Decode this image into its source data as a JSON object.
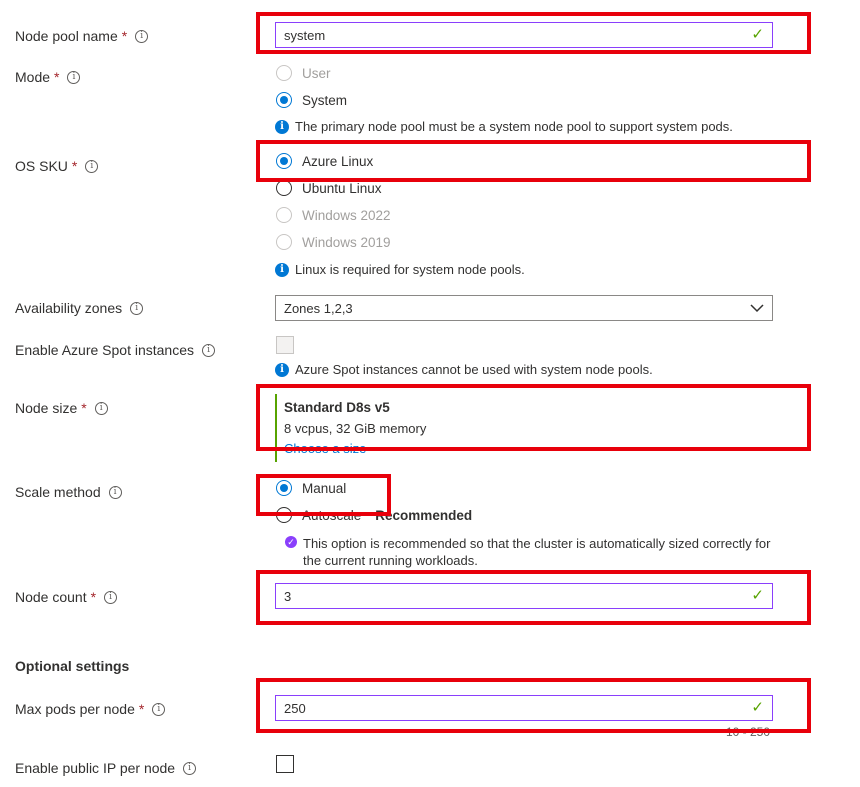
{
  "fields": {
    "node_pool_name": {
      "label": "Node pool name",
      "value": "system"
    },
    "mode": {
      "label": "Mode",
      "options": [
        "User",
        "System"
      ],
      "note": "The primary node pool must be a system node pool to support system pods."
    },
    "os_sku": {
      "label": "OS SKU",
      "options": [
        "Azure Linux",
        "Ubuntu Linux",
        "Windows 2022",
        "Windows 2019"
      ],
      "note": "Linux is required for system node pools."
    },
    "availability_zones": {
      "label": "Availability zones",
      "value": "Zones 1,2,3"
    },
    "spot": {
      "label": "Enable Azure Spot instances",
      "note": "Azure Spot instances cannot be used with system node pools."
    },
    "node_size": {
      "label": "Node size",
      "name": "Standard D8s v5",
      "specs": "8 vcpus, 32 GiB memory",
      "link": "Choose a size"
    },
    "scale_method": {
      "label": "Scale method",
      "options": [
        "Manual",
        "Autoscale"
      ],
      "recommended": "Recommended",
      "note": "This option is recommended so that the cluster is automatically sized correctly for the current running workloads."
    },
    "node_count": {
      "label": "Node count",
      "value": "3"
    },
    "optional_heading": "Optional settings",
    "max_pods": {
      "label": "Max pods per node",
      "value": "250",
      "range": "10 - 250"
    },
    "public_ip": {
      "label": "Enable public IP per node"
    }
  },
  "icons": {
    "info": "info-icon",
    "check": "checkmark-icon",
    "chevron": "chevron-down-icon"
  },
  "colors": {
    "accent": "#0078d4",
    "highlight": "#e8000b",
    "valid": "#57a300",
    "focus": "#8a3ffc"
  }
}
